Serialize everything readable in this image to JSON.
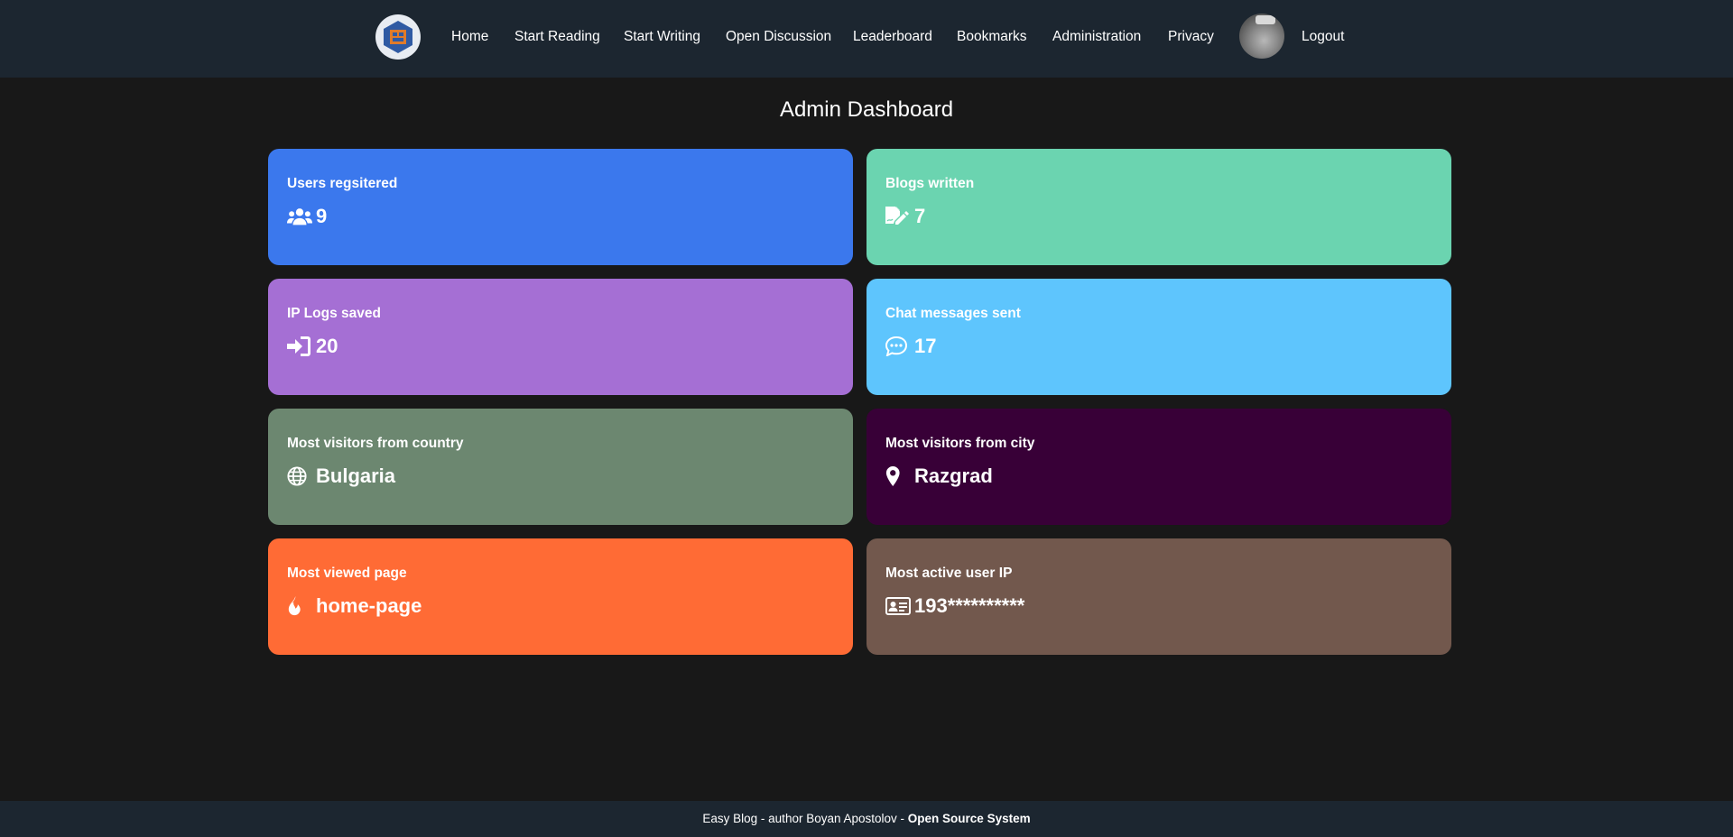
{
  "nav": {
    "links": [
      "Home",
      "Start Reading",
      "Start Writing",
      "Open Discussion",
      "Leaderboard",
      "Bookmarks",
      "Administration",
      "Privacy"
    ],
    "logout": "Logout"
  },
  "page": {
    "title": "Admin Dashboard"
  },
  "cards": [
    {
      "label": "Users regsitered",
      "value": "9",
      "icon": "users-icon",
      "color": "#3b78ed"
    },
    {
      "label": "Blogs written",
      "value": "7",
      "icon": "file-signature-icon",
      "color": "#6bd4b0"
    },
    {
      "label": "IP Logs saved",
      "value": "20",
      "icon": "sign-in-icon",
      "color": "#a56fd4"
    },
    {
      "label": "Chat messages sent",
      "value": "17",
      "icon": "comment-dots-icon",
      "color": "#5ec5fd"
    },
    {
      "label": "Most visitors from country",
      "value": "Bulgaria",
      "icon": "globe-icon",
      "color": "#6c8770"
    },
    {
      "label": "Most visitors from city",
      "value": "Razgrad",
      "icon": "map-marker-icon",
      "color": "#380037"
    },
    {
      "label": "Most viewed page",
      "value": "home-page",
      "icon": "fire-icon",
      "color": "#ff6b35"
    },
    {
      "label": "Most active user IP",
      "value": "193**********",
      "icon": "id-card-icon",
      "color": "#72584d"
    }
  ],
  "footer": {
    "text": "Easy Blog -  author Boyan Apostolov -",
    "bold": "Open Source System"
  }
}
